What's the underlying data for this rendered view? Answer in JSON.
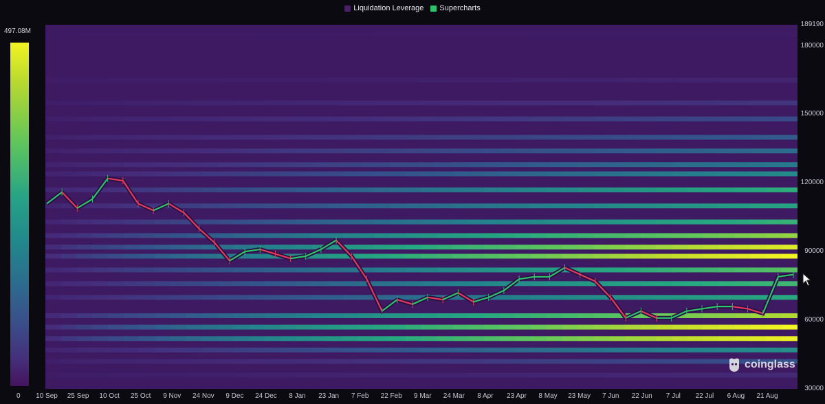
{
  "legend": {
    "items": [
      {
        "label": "Liquidation Leverage",
        "color": "#4b1e6a"
      },
      {
        "label": "Supercharts",
        "color": "#2ec26b"
      }
    ]
  },
  "colorbar": {
    "max_label": "497.08M",
    "min_label": "0"
  },
  "brand": {
    "name": "coinglass"
  },
  "chart_data": {
    "type": "heatmap",
    "title": "",
    "xlabel": "",
    "ylabel": "",
    "ylim": [
      30000,
      189190
    ],
    "y_top_label": "189190",
    "y_ticks": [
      "180000",
      "150000",
      "120000",
      "90000",
      "60000",
      "30000"
    ],
    "x_ticks": [
      "10 Sep",
      "25 Sep",
      "10 Oct",
      "25 Oct",
      "9 Nov",
      "24 Nov",
      "9 Dec",
      "24 Dec",
      "8 Jan",
      "23 Jan",
      "7 Feb",
      "22 Feb",
      "9 Mar",
      "24 Mar",
      "8 Apr",
      "23 Apr",
      "8 May",
      "23 May",
      "7 Jun",
      "22 Jun",
      "7 Jul",
      "22 Jul",
      "6 Aug",
      "21 Aug"
    ],
    "colorscale": {
      "min": 0,
      "max": "497.08M",
      "colors": [
        "#45135e",
        "#3a4d8a",
        "#21888c",
        "#5cc45e",
        "#f2f422"
      ]
    },
    "price_series": {
      "x": [
        "10 Sep",
        "17 Sep",
        "25 Sep",
        "2 Oct",
        "7 Oct",
        "10 Oct",
        "14 Oct",
        "18 Oct",
        "25 Oct",
        "1 Nov",
        "9 Nov",
        "16 Nov",
        "24 Nov",
        "1 Dec",
        "9 Dec",
        "16 Dec",
        "24 Dec",
        "1 Jan",
        "8 Jan",
        "14 Jan",
        "23 Jan",
        "1 Feb",
        "7 Feb",
        "14 Feb",
        "22 Feb",
        "1 Mar",
        "9 Mar",
        "16 Mar",
        "24 Mar",
        "1 Apr",
        "8 Apr",
        "16 Apr",
        "23 Apr",
        "1 May",
        "8 May",
        "16 May",
        "23 May",
        "1 Jun",
        "7 Jun",
        "14 Jun",
        "22 Jun",
        "1 Jul",
        "7 Jul",
        "14 Jul",
        "22 Jul",
        "1 Aug",
        "6 Aug",
        "14 Aug",
        "21 Aug",
        "28 Aug"
      ],
      "values": [
        111000,
        116000,
        109000,
        113000,
        122000,
        121000,
        111000,
        108000,
        111000,
        107000,
        100000,
        94000,
        86000,
        90000,
        91000,
        89000,
        87000,
        88000,
        91000,
        95000,
        88000,
        78000,
        64000,
        69000,
        67000,
        70000,
        69000,
        72000,
        68000,
        70000,
        73000,
        78000,
        79000,
        79000,
        83000,
        80000,
        77000,
        70000,
        61000,
        64000,
        61000,
        61000,
        64000,
        65000,
        66000,
        66000,
        65000,
        63000,
        79000,
        80000
      ]
    },
    "bands": [
      {
        "price": 185000,
        "intensity": 0.02
      },
      {
        "price": 165000,
        "intensity": 0.08
      },
      {
        "price": 155000,
        "intensity": 0.18
      },
      {
        "price": 148000,
        "intensity": 0.26
      },
      {
        "price": 140000,
        "intensity": 0.32
      },
      {
        "price": 134000,
        "intensity": 0.38
      },
      {
        "price": 128000,
        "intensity": 0.42
      },
      {
        "price": 124000,
        "intensity": 0.48
      },
      {
        "price": 117000,
        "intensity": 0.62
      },
      {
        "price": 110000,
        "intensity": 0.58
      },
      {
        "price": 103000,
        "intensity": 0.64
      },
      {
        "price": 97000,
        "intensity": 0.82
      },
      {
        "price": 92000,
        "intensity": 0.95
      },
      {
        "price": 88000,
        "intensity": 1.0
      },
      {
        "price": 82000,
        "intensity": 0.72
      },
      {
        "price": 76000,
        "intensity": 0.66
      },
      {
        "price": 70000,
        "intensity": 0.6
      },
      {
        "price": 62000,
        "intensity": 0.86
      },
      {
        "price": 57000,
        "intensity": 1.0
      },
      {
        "price": 52000,
        "intensity": 0.98
      },
      {
        "price": 47000,
        "intensity": 0.5
      },
      {
        "price": 42000,
        "intensity": 0.28
      },
      {
        "price": 36000,
        "intensity": 0.12
      }
    ]
  }
}
